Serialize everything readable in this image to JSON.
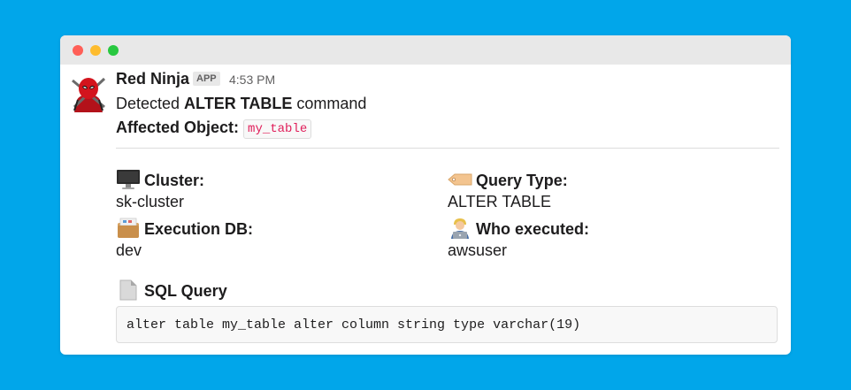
{
  "message": {
    "sender": "Red Ninja",
    "badge": "APP",
    "time": "4:53 PM",
    "text_prefix": "Detected ",
    "command": "ALTER TABLE",
    "text_suffix": " command",
    "affected_label": "Affected Object",
    "affected_colon": ":",
    "affected_object": "my_table"
  },
  "fields": {
    "cluster": {
      "title": "Cluster:",
      "value": "sk-cluster",
      "icon": "computer-icon"
    },
    "query_type": {
      "title": "Query Type:",
      "value": "ALTER TABLE",
      "icon": "tag-icon"
    },
    "execution_db": {
      "title": "Execution DB:",
      "value": "dev",
      "icon": "file-cabinet-icon"
    },
    "who_executed": {
      "title": "Who executed:",
      "value": "awsuser",
      "icon": "technologist-icon"
    }
  },
  "sql": {
    "title": "SQL Query",
    "icon": "page-icon",
    "code": "alter table my_table alter column string type varchar(19)"
  },
  "colors": {
    "background": "#01a6ea",
    "inline_code": "#e01e5a"
  }
}
